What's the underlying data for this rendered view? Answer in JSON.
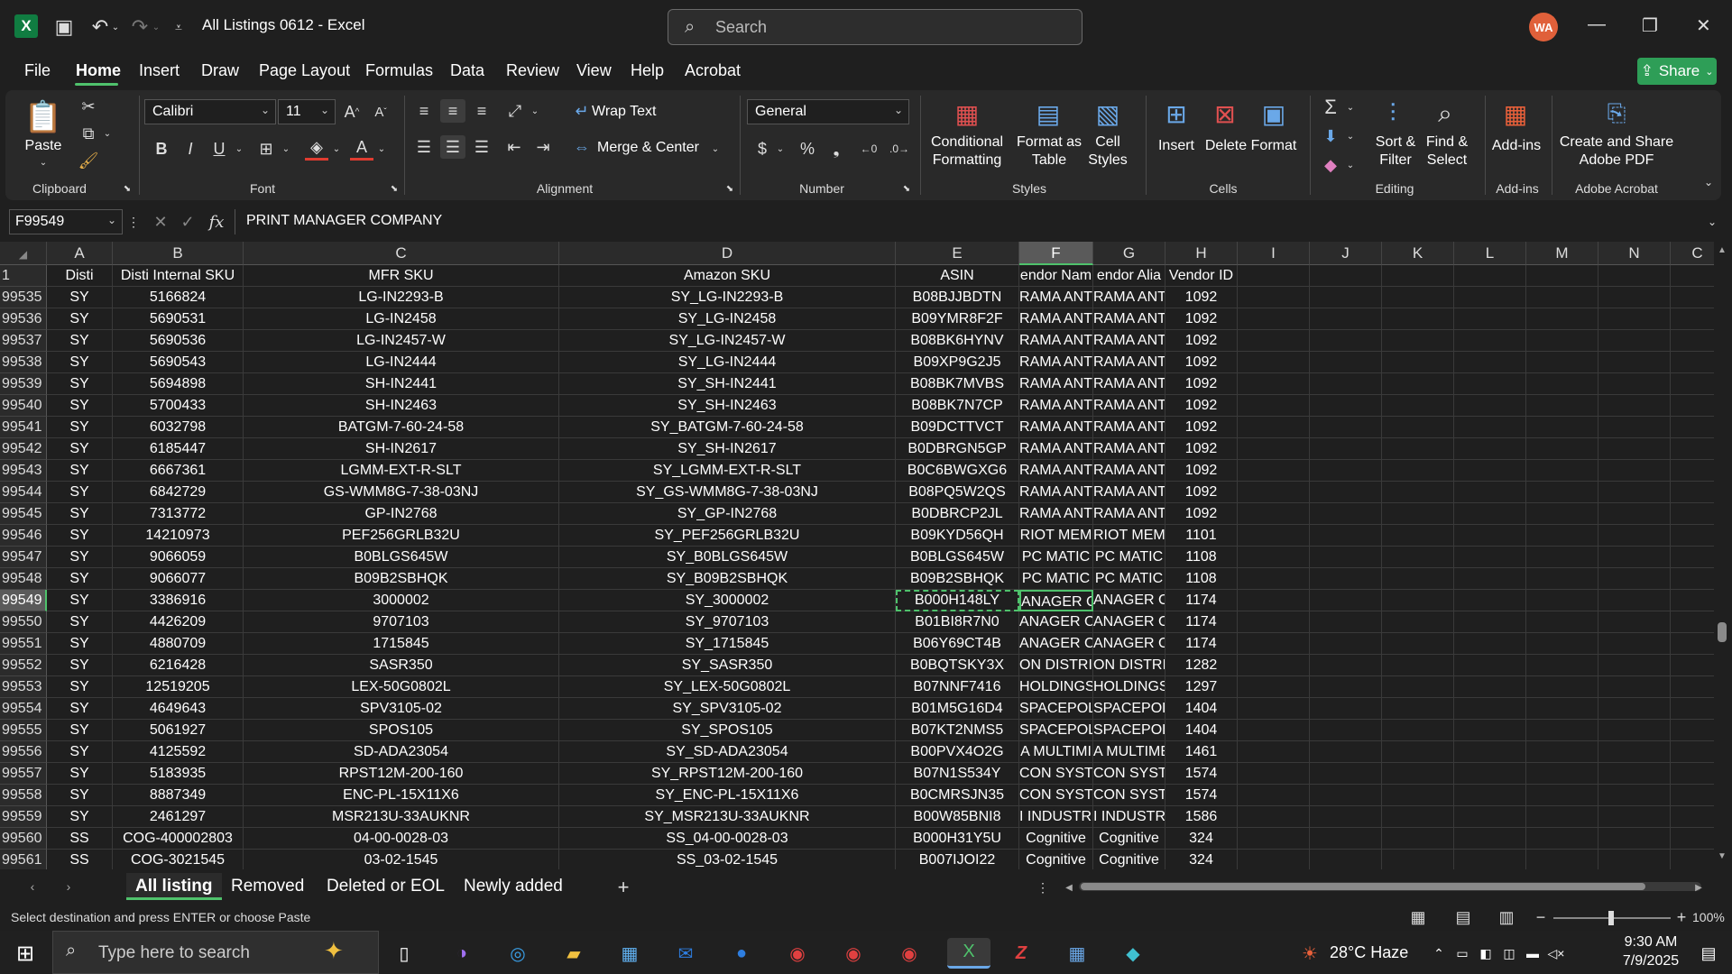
{
  "title_bar": {
    "app_icon": "excel-icon",
    "title": "All Listings 0612  -  Excel",
    "search_placeholder": "Search",
    "user_initials": "WA"
  },
  "menu": {
    "items": [
      "File",
      "Home",
      "Insert",
      "Draw",
      "Page Layout",
      "Formulas",
      "Data",
      "Review",
      "View",
      "Help",
      "Acrobat"
    ],
    "active": "Home",
    "share_label": "Share"
  },
  "ribbon": {
    "clipboard": {
      "paste": "Paste",
      "label": "Clipboard"
    },
    "font": {
      "name": "Calibri",
      "size": "11",
      "label": "Font"
    },
    "alignment": {
      "wrap": "Wrap Text",
      "merge": "Merge & Center",
      "label": "Alignment"
    },
    "number": {
      "format": "General",
      "label": "Number"
    },
    "styles": {
      "conditional": "Conditional\nFormatting",
      "format_table": "Format as\nTable",
      "cell_styles": "Cell\nStyles",
      "label": "Styles"
    },
    "cells": {
      "insert": "Insert",
      "delete": "Delete",
      "format": "Format",
      "label": "Cells"
    },
    "editing": {
      "sort": "Sort &\nFilter",
      "find": "Find &\nSelect",
      "label": "Editing"
    },
    "addins": {
      "addins": "Add-ins",
      "label": "Add-ins"
    },
    "acrobat": {
      "create": "Create and Share\nAdobe PDF",
      "label": "Adobe Acrobat"
    }
  },
  "formula_bar": {
    "name_box": "F99549",
    "content": "PRINT MANAGER COMPANY"
  },
  "columns": [
    "A",
    "B",
    "C",
    "D",
    "E",
    "F",
    "G",
    "H",
    "I",
    "J",
    "K",
    "L",
    "M",
    "N",
    "C"
  ],
  "header_row": {
    "row": "1",
    "cells": [
      "Disti",
      "Disti Internal SKU",
      "MFR SKU",
      "Amazon SKU",
      "ASIN",
      "endor Nam",
      "endor Alia",
      "Vendor ID"
    ]
  },
  "rows": [
    [
      "99535",
      "SY",
      "5166824",
      "LG-IN2293-B",
      "SY_LG-IN2293-B",
      "B08BJJBDTN",
      "RAMA ANT",
      "RAMA ANTI",
      "1092"
    ],
    [
      "99536",
      "SY",
      "5690531",
      "LG-IN2458",
      "SY_LG-IN2458",
      "B09YMR8F2F",
      "RAMA ANT",
      "RAMA ANTI",
      "1092"
    ],
    [
      "99537",
      "SY",
      "5690536",
      "LG-IN2457-W",
      "SY_LG-IN2457-W",
      "B08BK6HYNV",
      "RAMA ANT",
      "RAMA ANTI",
      "1092"
    ],
    [
      "99538",
      "SY",
      "5690543",
      "LG-IN2444",
      "SY_LG-IN2444",
      "B09XP9G2J5",
      "RAMA ANT",
      "RAMA ANTI",
      "1092"
    ],
    [
      "99539",
      "SY",
      "5694898",
      "SH-IN2441",
      "SY_SH-IN2441",
      "B08BK7MVBS",
      "RAMA ANT",
      "RAMA ANTI",
      "1092"
    ],
    [
      "99540",
      "SY",
      "5700433",
      "SH-IN2463",
      "SY_SH-IN2463",
      "B08BK7N7CP",
      "RAMA ANT",
      "RAMA ANTI",
      "1092"
    ],
    [
      "99541",
      "SY",
      "6032798",
      "BATGM-7-60-24-58",
      "SY_BATGM-7-60-24-58",
      "B09DCTTVCT",
      "RAMA ANT",
      "RAMA ANTI",
      "1092"
    ],
    [
      "99542",
      "SY",
      "6185447",
      "SH-IN2617",
      "SY_SH-IN2617",
      "B0DBRGN5GP",
      "RAMA ANT",
      "RAMA ANTI",
      "1092"
    ],
    [
      "99543",
      "SY",
      "6667361",
      "LGMM-EXT-R-SLT",
      "SY_LGMM-EXT-R-SLT",
      "B0C6BWGXG6",
      "RAMA ANT",
      "RAMA ANTI",
      "1092"
    ],
    [
      "99544",
      "SY",
      "6842729",
      "GS-WMM8G-7-38-03NJ",
      "SY_GS-WMM8G-7-38-03NJ",
      "B08PQ5W2QS",
      "RAMA ANT",
      "RAMA ANTI",
      "1092"
    ],
    [
      "99545",
      "SY",
      "7313772",
      "GP-IN2768",
      "SY_GP-IN2768",
      "B0DBRCP2JL",
      "RAMA ANT",
      "RAMA ANTI",
      "1092"
    ],
    [
      "99546",
      "SY",
      "14210973",
      "PEF256GRLB32U",
      "SY_PEF256GRLB32U",
      "B09KYD56QH",
      "RIOT MEM",
      "RIOT MEM",
      "1101"
    ],
    [
      "99547",
      "SY",
      "9066059",
      "B0BLGS645W",
      "SY_B0BLGS645W",
      "B0BLGS645W",
      "PC MATIC",
      "PC MATIC",
      "1108"
    ],
    [
      "99548",
      "SY",
      "9066077",
      "B09B2SBHQK",
      "SY_B09B2SBHQK",
      "B09B2SBHQK",
      "PC MATIC",
      "PC MATIC",
      "1108"
    ],
    [
      "99549",
      "SY",
      "3386916",
      "3000002",
      "SY_3000002",
      "B000H148LY",
      "ANAGER C",
      "ANAGER C",
      "1174"
    ],
    [
      "99550",
      "SY",
      "4426209",
      "9707103",
      "SY_9707103",
      "B01BI8R7N0",
      "ANAGER C",
      "ANAGER C",
      "1174"
    ],
    [
      "99551",
      "SY",
      "4880709",
      "1715845",
      "SY_1715845",
      "B06Y69CT4B",
      "ANAGER C",
      "ANAGER C",
      "1174"
    ],
    [
      "99552",
      "SY",
      "6216428",
      "SASR350",
      "SY_SASR350",
      "B0BQTSKY3X",
      "ON DISTRIB",
      "ON DISTRIB",
      "1282"
    ],
    [
      "99553",
      "SY",
      "12519205",
      "LEX-50G0802L",
      "SY_LEX-50G0802L",
      "B07NNF7416",
      "HOLDINGS",
      "HOLDINGS",
      "1297"
    ],
    [
      "99554",
      "SY",
      "4649643",
      "SPV3105-02",
      "SY_SPV3105-02",
      "B01M5G16D4",
      "SPACEPOLE",
      "SPACEPOLE",
      "1404"
    ],
    [
      "99555",
      "SY",
      "5061927",
      "SPOS105",
      "SY_SPOS105",
      "B07KT2NMS5",
      "SPACEPOLE",
      "SPACEPOLE",
      "1404"
    ],
    [
      "99556",
      "SY",
      "4125592",
      "SD-ADA23054",
      "SY_SD-ADA23054",
      "B00PVX4O2G",
      "A MULTIMI",
      "A MULTIME",
      "1461"
    ],
    [
      "99557",
      "SY",
      "5183935",
      "RPST12M-200-160",
      "SY_RPST12M-200-160",
      "B07N1S534Y",
      "CON SYSTE",
      "CON SYSTE",
      "1574"
    ],
    [
      "99558",
      "SY",
      "8887349",
      "ENC-PL-15X11X6",
      "SY_ENC-PL-15X11X6",
      "B0CMRSJN35",
      "CON SYSTE",
      "CON SYSTE",
      "1574"
    ],
    [
      "99559",
      "SY",
      "2461297",
      "MSR213U-33AUKNR",
      "SY_MSR213U-33AUKNR",
      "B00W85BNI8",
      "I INDUSTRI",
      "I INDUSTR",
      "1586"
    ],
    [
      "99560",
      "SS",
      "COG-400002803",
      "04-00-0028-03",
      "SS_04-00-0028-03",
      "B000H31Y5U",
      "Cognitive",
      "Cognitive",
      "324"
    ],
    [
      "99561",
      "SS",
      "COG-3021545",
      "03-02-1545",
      "SS_03-02-1545",
      "B007IJOI22",
      "Cognitive",
      "Cognitive",
      "324"
    ]
  ],
  "selected_row": "99549",
  "sheets": [
    "All listing",
    "Removed",
    "Deleted or EOL",
    "Newly added"
  ],
  "active_sheet": "All listing",
  "status": {
    "message": "Select destination and press ENTER or choose Paste",
    "zoom": "100%"
  },
  "taskbar": {
    "search_placeholder": "Type here to search",
    "weather": "28°C  Haze",
    "time": "9:30 AM",
    "date": "7/9/2025"
  },
  "colors": {
    "accent": "#4fc26c",
    "excel": "#107c41",
    "share": "#2e9e57"
  }
}
